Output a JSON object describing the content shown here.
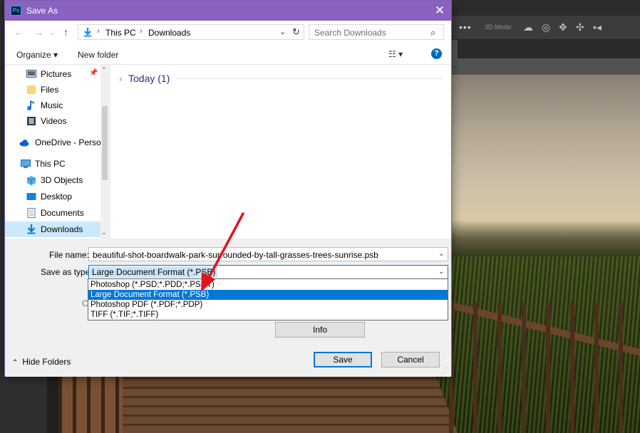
{
  "dialog": {
    "title": "Save As",
    "app_logo": "Ps"
  },
  "nav": {
    "back_icon": "←",
    "forward_icon": "→",
    "dropdown_icon": "⌄",
    "up_icon": "↑",
    "breadcrumb": [
      "This PC",
      "Downloads"
    ],
    "search_placeholder": "Search Downloads"
  },
  "commands": {
    "organize": "Organize ▾",
    "new_folder": "New folder"
  },
  "sidebar": {
    "items": [
      {
        "label": "Pictures",
        "icon": "pictures-icon",
        "pinned": true
      },
      {
        "label": "Files",
        "icon": "folder-icon"
      },
      {
        "label": "Music",
        "icon": "music-icon"
      },
      {
        "label": "Videos",
        "icon": "videos-icon"
      },
      {
        "label": "OneDrive - Persor",
        "icon": "onedrive-icon"
      },
      {
        "label": "This PC",
        "icon": "pc-icon"
      },
      {
        "label": "3D Objects",
        "icon": "3d-objects-icon"
      },
      {
        "label": "Desktop",
        "icon": "desktop-icon"
      },
      {
        "label": "Documents",
        "icon": "documents-icon"
      },
      {
        "label": "Downloads",
        "icon": "downloads-icon",
        "selected": true
      }
    ]
  },
  "content": {
    "group_label": "Today (1)"
  },
  "form": {
    "file_name_label": "File name:",
    "file_name": "beautiful-shot-boardwalk-park-surrounded-by-tall-grasses-trees-sunrise.psb",
    "save_as_type_label": "Save as type:",
    "save_as_type": "Large Document Format (*.PSB)",
    "hidden_label": "Co",
    "info": "Info",
    "hide_folders": "Hide Folders",
    "save": "Save",
    "cancel": "Cancel"
  },
  "type_options": [
    "Photoshop (*.PSD;*.PDD;*.PSDT)",
    "Large Document Format (*.PSB)",
    "Photoshop PDF (*.PDF;*.PDP)",
    "TIFF (*.TIF;*.TIFF)"
  ],
  "type_selected_index": 1,
  "photoshop": {
    "mode_label": "3D Mode:",
    "more_label": "•••"
  },
  "colors": {
    "title_bar": "#8a62c2",
    "selection": "#0078d7",
    "annotation_arrow": "#e0141e"
  }
}
